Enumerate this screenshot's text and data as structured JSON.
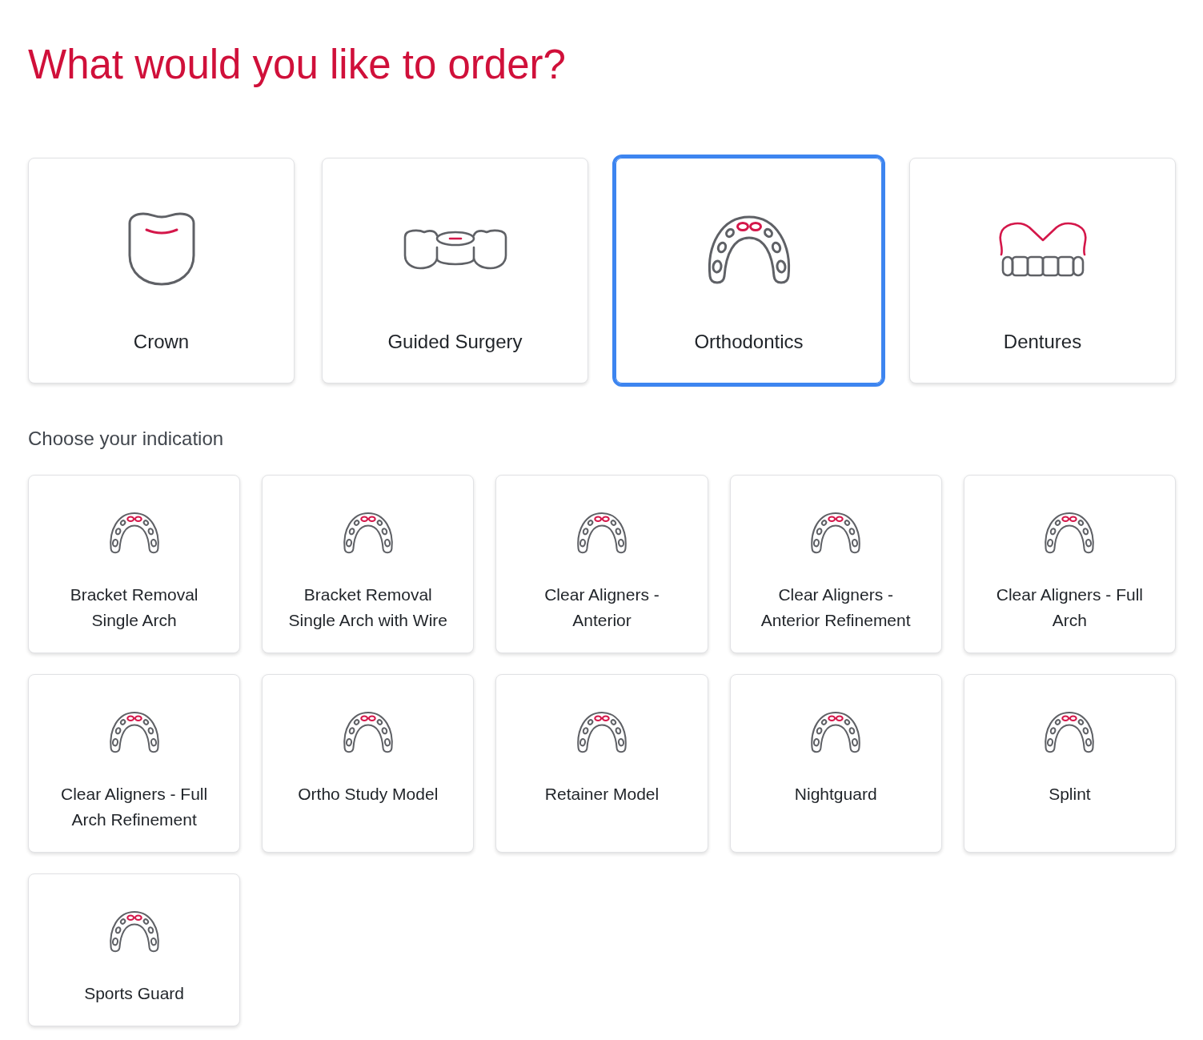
{
  "title": "What would you like to order?",
  "categories": [
    {
      "label": "Crown",
      "kind": "crown",
      "selected": false
    },
    {
      "label": "Guided Surgery",
      "kind": "bridge",
      "selected": false
    },
    {
      "label": "Orthodontics",
      "kind": "arch",
      "selected": true
    },
    {
      "label": "Dentures",
      "kind": "denture",
      "selected": false
    }
  ],
  "indication_heading": "Choose your indication",
  "indications": [
    {
      "label": "Bracket Removal Single Arch"
    },
    {
      "label": "Bracket Removal Single Arch with Wire"
    },
    {
      "label": "Clear Aligners - Anterior"
    },
    {
      "label": "Clear Aligners - Anterior Refinement"
    },
    {
      "label": "Clear Aligners - Full Arch"
    },
    {
      "label": "Clear Aligners - Full Arch Refinement"
    },
    {
      "label": "Ortho Study Model"
    },
    {
      "label": "Retainer Model"
    },
    {
      "label": "Nightguard"
    },
    {
      "label": "Splint"
    },
    {
      "label": "Sports Guard"
    }
  ]
}
